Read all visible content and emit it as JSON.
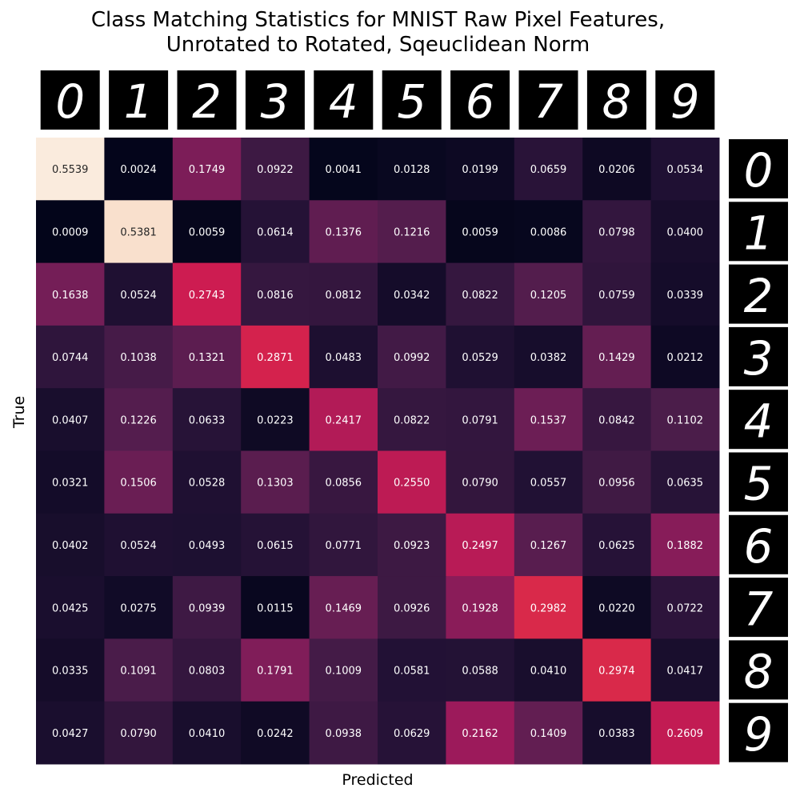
{
  "chart_data": {
    "type": "heatmap",
    "title_lines": [
      "Class Matching Statistics for MNIST Raw Pixel Features,",
      "Unrotated to Rotated, Sqeuclidean Norm"
    ],
    "xlabel": "Predicted",
    "ylabel": "True",
    "x_categories": [
      "0",
      "1",
      "2",
      "3",
      "4",
      "5",
      "6",
      "7",
      "8",
      "9"
    ],
    "y_categories": [
      "0",
      "1",
      "2",
      "3",
      "4",
      "5",
      "6",
      "7",
      "8",
      "9"
    ],
    "tick_style": "digit images (MNIST samples) instead of text tick labels",
    "colormap": "rocket",
    "colorbar": false,
    "grid": false,
    "annotation_format": "4 decimals",
    "values": [
      [
        0.5539,
        0.0024,
        0.1749,
        0.0922,
        0.0041,
        0.0128,
        0.0199,
        0.0659,
        0.0206,
        0.0534
      ],
      [
        0.0009,
        0.5381,
        0.0059,
        0.0614,
        0.1376,
        0.1216,
        0.0059,
        0.0086,
        0.0798,
        0.04
      ],
      [
        0.1638,
        0.0524,
        0.2743,
        0.0816,
        0.0812,
        0.0342,
        0.0822,
        0.1205,
        0.0759,
        0.0339
      ],
      [
        0.0744,
        0.1038,
        0.1321,
        0.2871,
        0.0483,
        0.0992,
        0.0529,
        0.0382,
        0.1429,
        0.0212
      ],
      [
        0.0407,
        0.1226,
        0.0633,
        0.0223,
        0.2417,
        0.0822,
        0.0791,
        0.1537,
        0.0842,
        0.1102
      ],
      [
        0.0321,
        0.1506,
        0.0528,
        0.1303,
        0.0856,
        0.255,
        0.079,
        0.0557,
        0.0956,
        0.0635
      ],
      [
        0.0402,
        0.0524,
        0.0493,
        0.0615,
        0.0771,
        0.0923,
        0.2497,
        0.1267,
        0.0625,
        0.1882
      ],
      [
        0.0425,
        0.0275,
        0.0939,
        0.0115,
        0.1469,
        0.0926,
        0.1928,
        0.2982,
        0.022,
        0.0722
      ],
      [
        0.0335,
        0.1091,
        0.0803,
        0.1791,
        0.1009,
        0.0581,
        0.0588,
        0.041,
        0.2974,
        0.0417
      ],
      [
        0.0427,
        0.079,
        0.041,
        0.0242,
        0.0938,
        0.0629,
        0.2162,
        0.1409,
        0.0383,
        0.2609
      ]
    ]
  }
}
